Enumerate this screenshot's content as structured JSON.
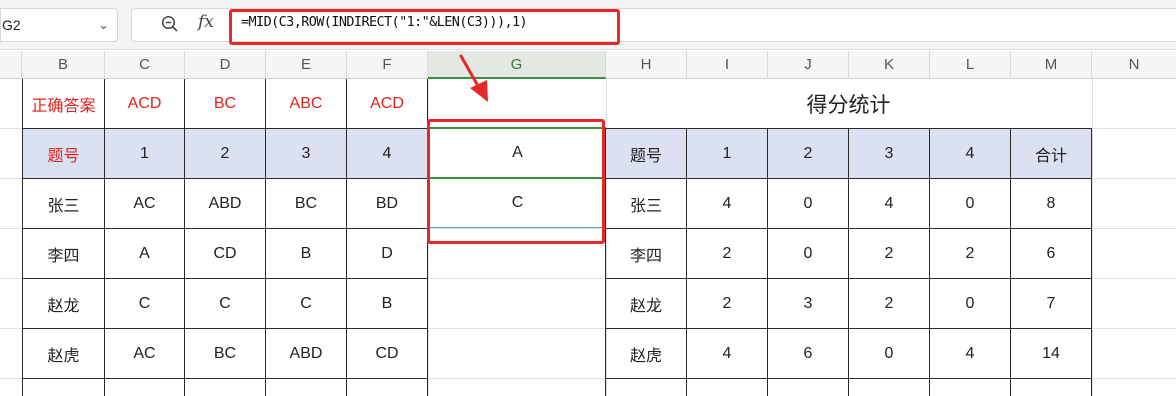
{
  "formula_bar": {
    "name_box": "G2",
    "fx_label": "fx",
    "formula": "=MID(C3,ROW(INDIRECT(\"1:\"&LEN(C3))),1)"
  },
  "columns": [
    "B",
    "C",
    "D",
    "E",
    "F",
    "G",
    "H",
    "I",
    "J",
    "K",
    "L",
    "M",
    "N"
  ],
  "answer_table": {
    "answer_row": {
      "label": "正确答案",
      "values": [
        "ACD",
        "BC",
        "ABC",
        "ACD"
      ]
    },
    "header_row": {
      "label": "题号",
      "values": [
        "1",
        "2",
        "3",
        "4"
      ]
    },
    "rows": [
      {
        "name": "张三",
        "values": [
          "AC",
          "ABD",
          "BC",
          "BD"
        ]
      },
      {
        "name": "李四",
        "values": [
          "A",
          "CD",
          "B",
          "D"
        ]
      },
      {
        "name": "赵龙",
        "values": [
          "C",
          "C",
          "C",
          "B"
        ]
      },
      {
        "name": "赵虎",
        "values": [
          "AC",
          "BC",
          "ABD",
          "CD"
        ]
      }
    ]
  },
  "g_column": {
    "values": [
      "A",
      "C"
    ]
  },
  "score_table": {
    "title": "得分统计",
    "header": [
      "题号",
      "1",
      "2",
      "3",
      "4",
      "合计"
    ],
    "rows": [
      {
        "name": "张三",
        "values": [
          "4",
          "0",
          "4",
          "0",
          "8"
        ]
      },
      {
        "name": "李四",
        "values": [
          "2",
          "0",
          "2",
          "2",
          "6"
        ]
      },
      {
        "name": "赵龙",
        "values": [
          "2",
          "3",
          "2",
          "0",
          "7"
        ]
      },
      {
        "name": "赵虎",
        "values": [
          "4",
          "6",
          "0",
          "4",
          "14"
        ]
      }
    ]
  },
  "colors": {
    "accent_red": "#e5282a",
    "selection_green": "#3b8f3e",
    "header_fill": "#dbe1f0"
  }
}
